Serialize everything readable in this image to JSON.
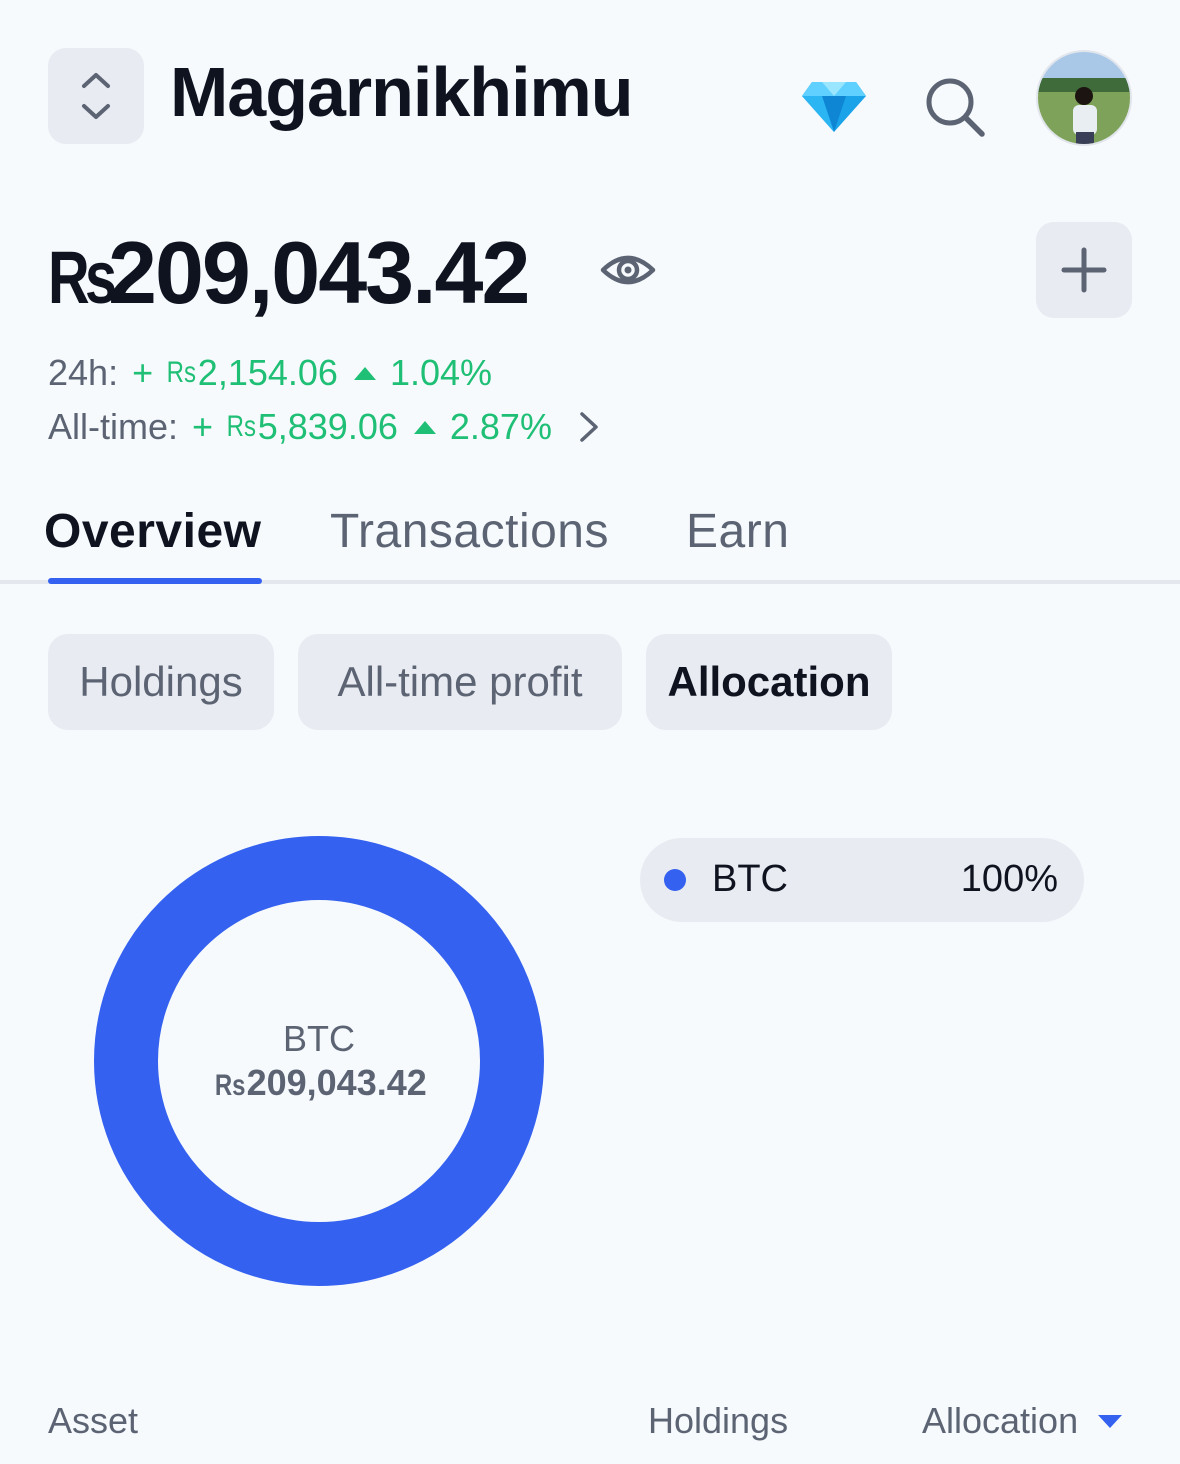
{
  "header": {
    "portfolio_name": "Magarnikhimu"
  },
  "balance": {
    "currency_symbol": "Rs",
    "amount": "209,043.42"
  },
  "changes": {
    "day_label": "24h:",
    "day_sign": "+",
    "day_currency": "Rs",
    "day_amount": "2,154.06",
    "day_pct": "1.04%",
    "all_label": "All-time:",
    "all_sign": "+",
    "all_currency": "Rs",
    "all_amount": "5,839.06",
    "all_pct": "2.87%"
  },
  "tabs": [
    {
      "label": "Overview",
      "active": true
    },
    {
      "label": "Transactions",
      "active": false
    },
    {
      "label": "Earn",
      "active": false
    }
  ],
  "chips": [
    {
      "label": "Holdings",
      "active": false
    },
    {
      "label": "All-time profit",
      "active": false
    },
    {
      "label": "Allocation",
      "active": true
    }
  ],
  "chart_data": {
    "type": "pie",
    "categories": [
      "BTC"
    ],
    "values": [
      100
    ],
    "colors": [
      "#3461f0"
    ],
    "center_label": "BTC",
    "center_currency": "Rs",
    "center_value": "209,043.42"
  },
  "legend": [
    {
      "name": "BTC",
      "pct": "100%",
      "color": "#3461f0"
    }
  ],
  "table_header": {
    "asset": "Asset",
    "holdings": "Holdings",
    "allocation": "Allocation"
  },
  "colors": {
    "accent": "#3461f0",
    "gain": "#1fbf75",
    "text_primary": "#0f1320",
    "text_secondary": "#5c6474",
    "chip_bg": "#e8ebf1"
  }
}
